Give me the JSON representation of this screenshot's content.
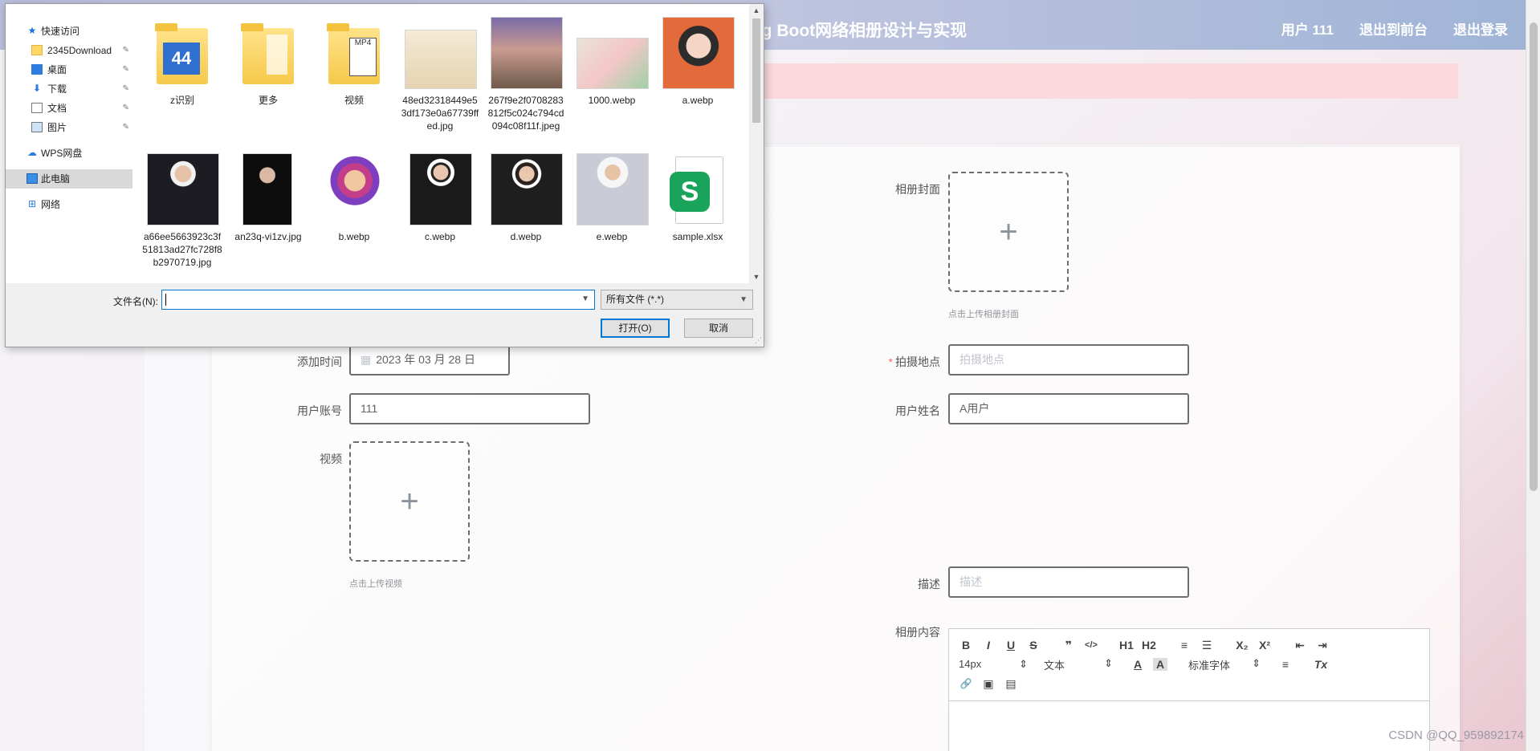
{
  "header": {
    "title": "ing Boot网络相册设计与实现",
    "nav": [
      "用户 111",
      "退出到前台",
      "退出登录"
    ],
    "colors": {
      "bar": "#b9bfdc",
      "alert": "#fbd9dc"
    }
  },
  "form": {
    "add_time": {
      "label": "添加时间",
      "value": "2023 年 03 月 28 日"
    },
    "user_account": {
      "label": "用户账号",
      "value": "111"
    },
    "video": {
      "label": "视频",
      "hint": "点击上传视频"
    },
    "cover": {
      "label": "相册封面",
      "hint": "点击上传相册封面"
    },
    "location": {
      "label": "拍摄地点",
      "required_mark": "*",
      "placeholder": "拍摄地点"
    },
    "user_name": {
      "label": "用户姓名",
      "value": "A用户"
    },
    "description": {
      "label": "描述",
      "placeholder": "描述"
    },
    "content": {
      "label": "相册内容"
    }
  },
  "editor": {
    "row1": [
      "B",
      "I",
      "U",
      "S",
      "❞",
      "</>",
      "H1",
      "H2",
      "≡",
      "☰",
      "X₂",
      "X²",
      "⇤",
      "⇥"
    ],
    "font_size": "14px",
    "text_type": "文本",
    "color_a": "A",
    "bg_a": "A",
    "font_family": "标准字体",
    "align": "≡",
    "clear": "Tx",
    "row3": [
      "🔗",
      "▣",
      "▤"
    ]
  },
  "watermark": "CSDN @QQ_959892174",
  "dialog": {
    "nav": {
      "quick_access": "快速访问",
      "items": [
        {
          "label": "2345Download",
          "icon": "folder-icon"
        },
        {
          "label": "桌面",
          "icon": "desktop-icon"
        },
        {
          "label": "下载",
          "icon": "download-icon"
        },
        {
          "label": "文档",
          "icon": "document-icon"
        },
        {
          "label": "图片",
          "icon": "picture-icon"
        }
      ],
      "wps": "WPS网盘",
      "this_pc": "此电脑",
      "network": "网络"
    },
    "files": [
      {
        "name": "z识别",
        "kind": "folder"
      },
      {
        "name": "更多",
        "kind": "folder"
      },
      {
        "name": "视频",
        "kind": "folder"
      },
      {
        "name": "48ed32318449e53df173e0a67739ffed.jpg",
        "kind": "image"
      },
      {
        "name": "267f9e2f0708283812f5c024c794cd094c08f11f.jpeg",
        "kind": "image"
      },
      {
        "name": "1000.webp",
        "kind": "image"
      },
      {
        "name": "a.webp",
        "kind": "image"
      },
      {
        "name": "a66ee5663923c3f51813ad27fc728f8b2970719.jpg",
        "kind": "image"
      },
      {
        "name": "an23q-vi1zv.jpg",
        "kind": "image"
      },
      {
        "name": "b.webp",
        "kind": "image"
      },
      {
        "name": "c.webp",
        "kind": "image"
      },
      {
        "name": "d.webp",
        "kind": "image"
      },
      {
        "name": "e.webp",
        "kind": "image"
      },
      {
        "name": "sample.xlsx",
        "kind": "spreadsheet"
      }
    ],
    "filename_label": "文件名(N):",
    "filename_value": "",
    "filetype": "所有文件 (*.*)",
    "open_button": "打开(O)",
    "cancel_button": "取消"
  }
}
